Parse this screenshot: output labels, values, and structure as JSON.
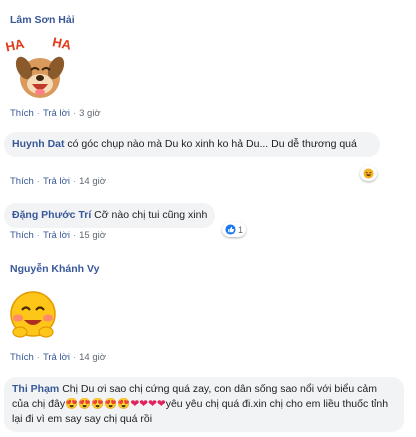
{
  "actions": {
    "like": "Thích",
    "reply": "Trả lời"
  },
  "comments": [
    {
      "author": "Lâm Sơn Hải",
      "text": "",
      "sticker": "laughing-dog-sticker",
      "sticker_text": "HA HA",
      "time": "3 giờ"
    },
    {
      "author": "Huynh Dat",
      "text": "có góc chụp nào mà Du ko xinh ko hả Du... Du dễ thương quá",
      "time": "14 giờ",
      "reaction": "haha-icon",
      "reaction_count": ""
    },
    {
      "author": "Đặng Phước Trí",
      "text": "Cỡ nào chị tui cũng xinh",
      "time": "15 giờ",
      "reaction": "like-icon",
      "reaction_count": "1"
    },
    {
      "author": "Nguyễn Khánh Vy",
      "text": "",
      "sticker": "shy-emoji-sticker",
      "time": "14 giờ"
    },
    {
      "author": "Thi Phạm",
      "text_part1": "Chị Du ơi sao chị cứng quá zay, con dân sống sao nổi với biểu cảm của chị đây",
      "emoji_row": "😍😍😍😍😍❤❤❤❤",
      "text_part2": "yêu yêu chị quá đi.xin chị cho em liều thuốc tỉnh lại đi vì em say say chị quá rồi"
    }
  ],
  "colors": {
    "name": "#385898",
    "bubble": "#f2f3f5",
    "meta": "#606770"
  }
}
